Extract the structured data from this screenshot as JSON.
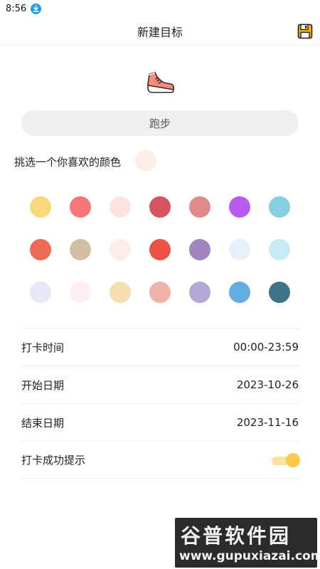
{
  "status_bar": {
    "time": "8:56"
  },
  "header": {
    "title": "新建目标"
  },
  "goal": {
    "name": "跑步"
  },
  "color_picker": {
    "label": "挑选一个你喜欢的颜色",
    "selected": "#fbeee6",
    "swatches": [
      "#f8d87a",
      "#f77779",
      "#fde3e0",
      "#d6535f",
      "#e08a8a",
      "#b85cf0",
      "#85d0e0",
      "#ed6a55",
      "#d1bfa5",
      "#fbeee6",
      "#ee5244",
      "#9e85bd",
      "#e7f1fd",
      "#c7eaf7",
      "#e6e8f9",
      "#fdeff2",
      "#f5deb0",
      "#f1b2a9",
      "#b4a8d7",
      "#62ade3",
      "#3e7389"
    ]
  },
  "settings": {
    "checkin_time": {
      "label": "打卡时间",
      "value": "00:00-23:59"
    },
    "start_date": {
      "label": "开始日期",
      "value": "2023-10-26"
    },
    "end_date": {
      "label": "结束日期",
      "value": "2023-11-16"
    },
    "success_tip": {
      "label": "打卡成功提示",
      "enabled": true
    }
  },
  "colors": {
    "accent": "#fbc84a",
    "save_icon": "#f5b400",
    "download_badge": "#1e9af0"
  },
  "icons": {
    "save": "save-icon",
    "goal": "running-shoe-icon",
    "download": "download-icon"
  },
  "watermark": {
    "line1": "谷普软件园",
    "line2": "www.gupuxiazai.com"
  }
}
